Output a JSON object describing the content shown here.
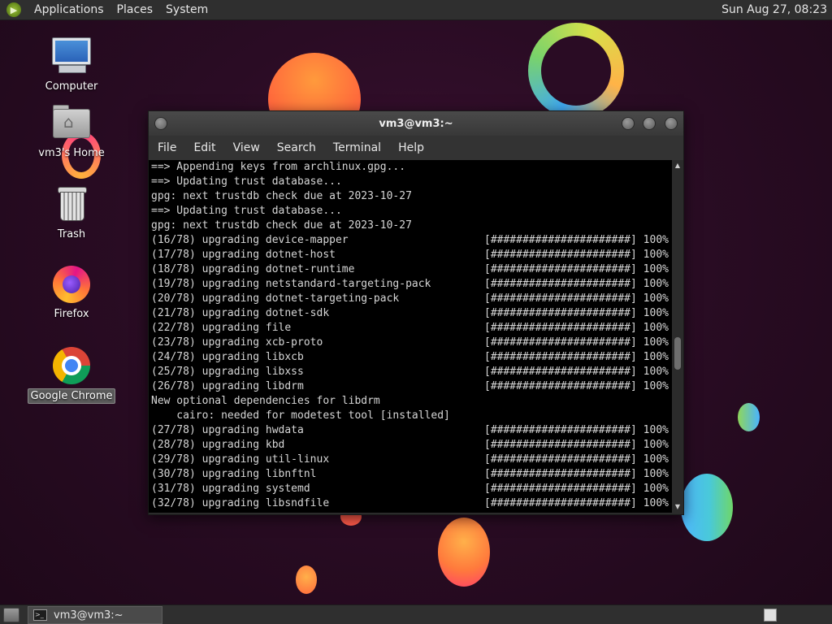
{
  "top_panel": {
    "menus": [
      "Applications",
      "Places",
      "System"
    ],
    "clock": "Sun Aug 27, 08:23"
  },
  "desktop_icons": [
    {
      "label": "Computer",
      "icon": "computer-icon"
    },
    {
      "label": "vm3's Home",
      "icon": "home-folder-icon"
    },
    {
      "label": "Trash",
      "icon": "trash-icon"
    },
    {
      "label": "Firefox",
      "icon": "firefox-icon"
    },
    {
      "label": "Google Chrome",
      "icon": "chrome-icon",
      "selected": true
    }
  ],
  "terminal": {
    "title": "vm3@vm3:~",
    "menu": [
      "File",
      "Edit",
      "View",
      "Search",
      "Terminal",
      "Help"
    ],
    "lines": [
      {
        "text": "==> Appending keys from archlinux.gpg..."
      },
      {
        "text": "==> Updating trust database..."
      },
      {
        "text": "gpg: next trustdb check due at 2023-10-27"
      },
      {
        "text": "==> Updating trust database..."
      },
      {
        "text": "gpg: next trustdb check due at 2023-10-27"
      },
      {
        "text": "(16/78) upgrading device-mapper",
        "progress": "[######################] 100%"
      },
      {
        "text": "(17/78) upgrading dotnet-host",
        "progress": "[######################] 100%"
      },
      {
        "text": "(18/78) upgrading dotnet-runtime",
        "progress": "[######################] 100%"
      },
      {
        "text": "(19/78) upgrading netstandard-targeting-pack",
        "progress": "[######################] 100%"
      },
      {
        "text": "(20/78) upgrading dotnet-targeting-pack",
        "progress": "[######################] 100%"
      },
      {
        "text": "(21/78) upgrading dotnet-sdk",
        "progress": "[######################] 100%"
      },
      {
        "text": "(22/78) upgrading file",
        "progress": "[######################] 100%"
      },
      {
        "text": "(23/78) upgrading xcb-proto",
        "progress": "[######################] 100%"
      },
      {
        "text": "(24/78) upgrading libxcb",
        "progress": "[######################] 100%"
      },
      {
        "text": "(25/78) upgrading libxss",
        "progress": "[######################] 100%"
      },
      {
        "text": "(26/78) upgrading libdrm",
        "progress": "[######################] 100%"
      },
      {
        "text": "New optional dependencies for libdrm"
      },
      {
        "text": "    cairo: needed for modetest tool [installed]"
      },
      {
        "text": "(27/78) upgrading hwdata",
        "progress": "[######################] 100%"
      },
      {
        "text": "(28/78) upgrading kbd",
        "progress": "[######################] 100%"
      },
      {
        "text": "(29/78) upgrading util-linux",
        "progress": "[######################] 100%"
      },
      {
        "text": "(30/78) upgrading libnftnl",
        "progress": "[######################] 100%"
      },
      {
        "text": "(31/78) upgrading systemd",
        "progress": "[######################] 100%"
      },
      {
        "text": "(32/78) upgrading libsndfile",
        "progress": "[######################] 100%"
      }
    ]
  },
  "bottom_panel": {
    "task_label": "vm3@vm3:~"
  }
}
